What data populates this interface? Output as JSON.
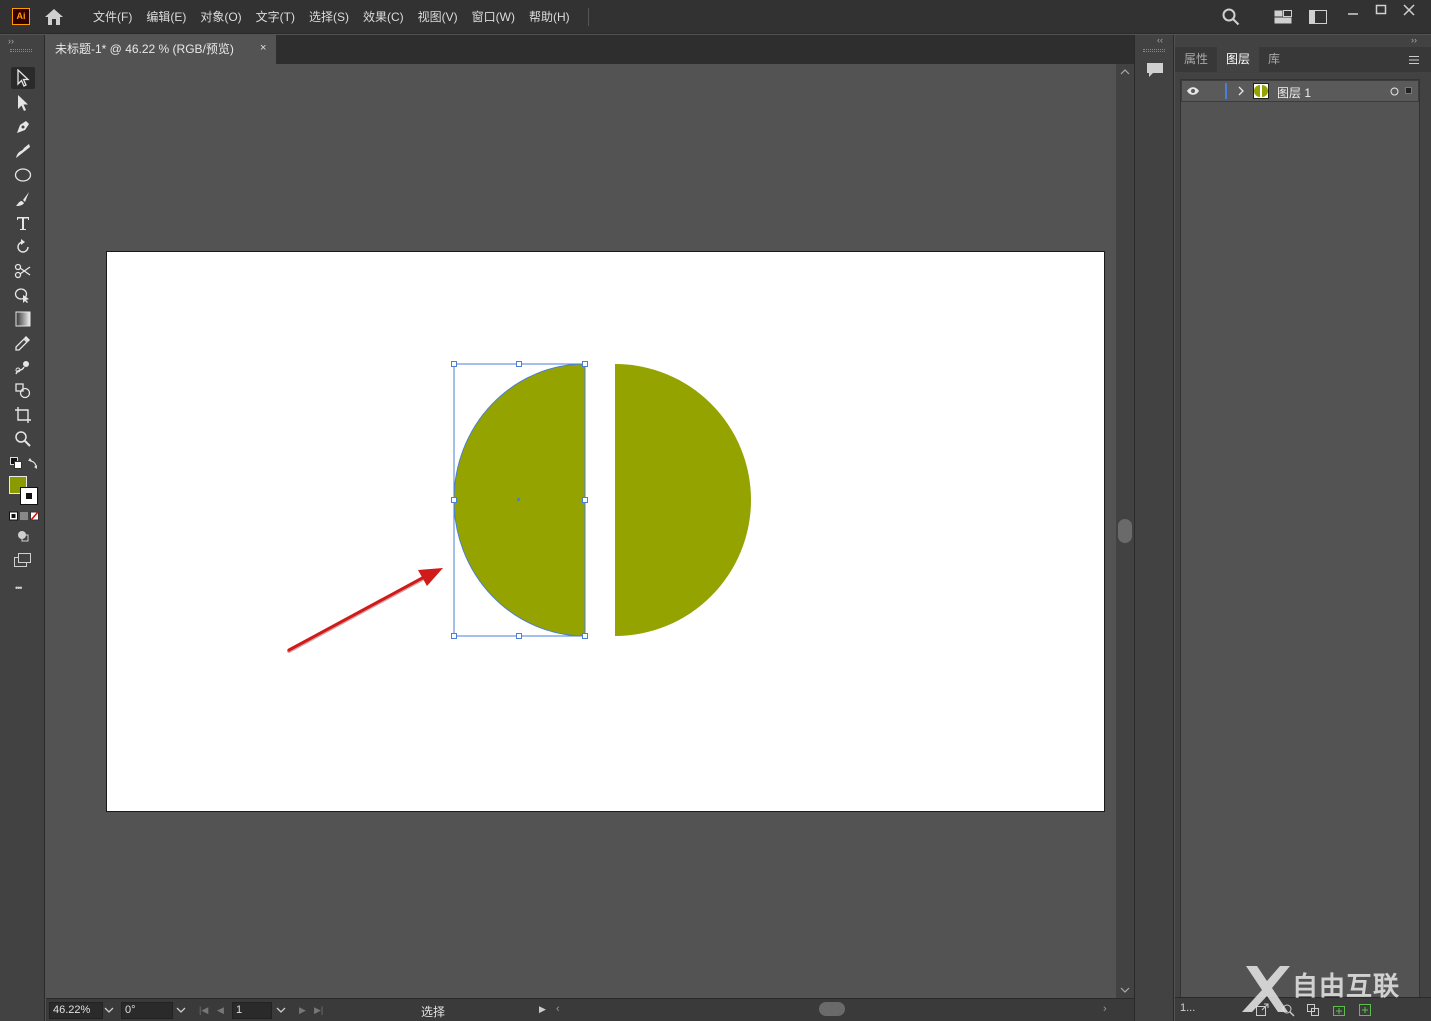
{
  "app": {
    "logo_text": "Ai",
    "menu": [
      "文件(F)",
      "编辑(E)",
      "对象(O)",
      "文字(T)",
      "选择(S)",
      "效果(C)",
      "视图(V)",
      "窗口(W)",
      "帮助(H)"
    ]
  },
  "document": {
    "tab_title": "未标题-1* @ 46.22 % (RGB/预览)",
    "close_glyph": "×"
  },
  "toolbar": {
    "tools": [
      "selection-tool",
      "direct-selection-tool",
      "pen-tool",
      "curvature-tool",
      "ellipse-tool",
      "paintbrush-tool",
      "type-tool",
      "rotate-tool",
      "scissors-tool",
      "shape-builder-tool",
      "gradient-tool",
      "eyedropper-tool",
      "blend-tool",
      "live-paint-tool",
      "artboard-tool",
      "zoom-tool"
    ],
    "more_glyph": "•••"
  },
  "colors": {
    "shape_fill": "#95a300",
    "selection": "#4a7fd4",
    "arrow": "#d11a1a",
    "fill_swatch": "#8a9a00"
  },
  "status": {
    "zoom": "46.22%",
    "rotation": "0°",
    "artboard_num": "1",
    "mode": "选择"
  },
  "panel": {
    "tabs": [
      "属性",
      "图层",
      "库"
    ],
    "active_tab": "图层",
    "layers": [
      {
        "name": "图层 1"
      }
    ],
    "layer_count": "1..."
  },
  "watermark": {
    "brand": "自由互联"
  }
}
